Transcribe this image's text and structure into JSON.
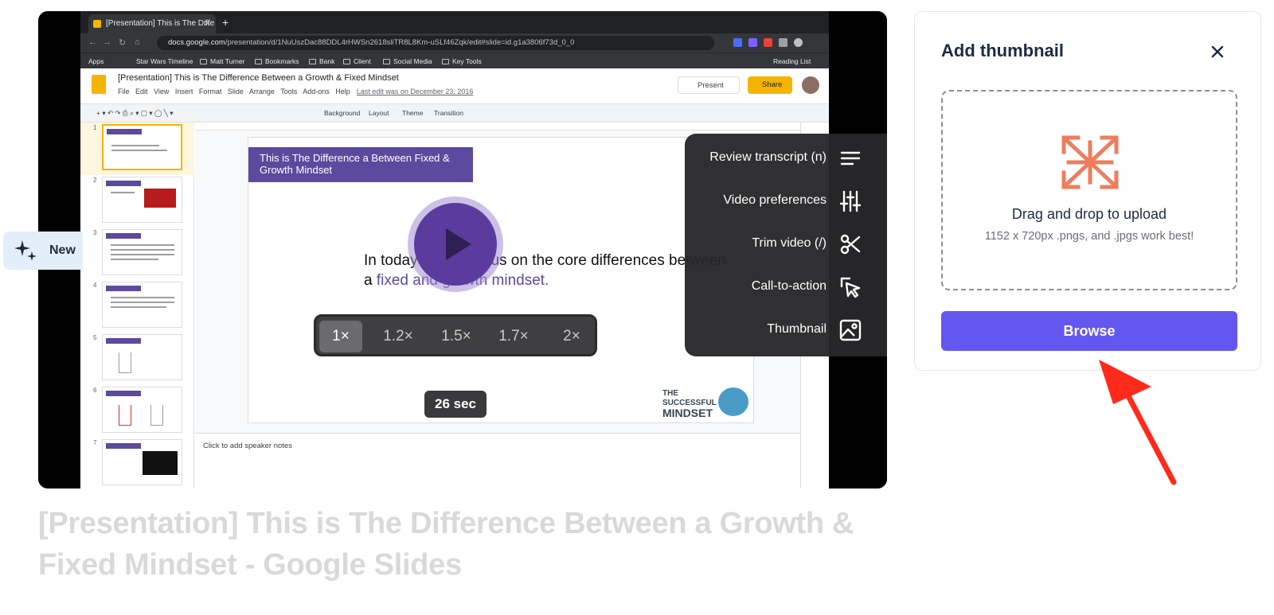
{
  "browser": {
    "tab_title": "[Presentation] This is The Diffe",
    "url_host": "docs.google.com",
    "url_path": "/presentation/d/1NuUszDac88DDL4rHWSn2618sliTR8L8Km-uSLf46Zqk/edit#slide=id.g1a3806f73d_0_0",
    "bookmarks": [
      "Apps",
      "Star Wars Timeline",
      "Matt Turner",
      "Bookmarks",
      "Bank",
      "Client",
      "Social Media",
      "Key Tools",
      "Reading List"
    ]
  },
  "slides_app": {
    "doc_title": "[Presentation] This is The Difference Between a Growth & Fixed Mindset",
    "menu": "File Edit View Insert Format Slide Arrange Tools Add-ons Help",
    "last_edit": "Last edit was on December 23, 2016",
    "present_label": "Present",
    "share_label": "Share",
    "toolbar": [
      "Background",
      "Layout",
      "Theme",
      "Transition"
    ],
    "slide_numbers": [
      "1",
      "2",
      "3",
      "4",
      "5",
      "6",
      "7"
    ],
    "slide_heading": "This is The  Difference a Between Fixed & Growth Mindset",
    "slide_body_start": "In today we will focus on the core differences between a ",
    "slide_body_highlight": "fixed and growth mindset.",
    "brand_small": "THE",
    "brand_line1": "SUCCESSFUL",
    "brand_line2": "MINDSET",
    "speaker_notes": "Click to add speaker notes"
  },
  "player": {
    "speeds": [
      "1×",
      "1.2×",
      "1.5×",
      "1.7×",
      "2×"
    ],
    "selected_speed": "1×",
    "duration": "26 sec",
    "menu": [
      {
        "label": "Review transcript (n)",
        "icon": "lines-icon"
      },
      {
        "label": "Video preferences",
        "icon": "sliders-icon"
      },
      {
        "label": "Trim video (/)",
        "icon": "scissors-icon"
      },
      {
        "label": "Call-to-action",
        "icon": "cursor-click-icon"
      },
      {
        "label": "Thumbnail",
        "icon": "image-icon"
      }
    ],
    "new_badge": "New"
  },
  "video_title": "[Presentation] This is The Difference Between a Growth & Fixed Mindset - Google Slides",
  "thumbnail_panel": {
    "title": "Add thumbnail",
    "drop_main": "Drag and drop to upload",
    "drop_sub": "1152 x 720px .pngs, and .jpgs work best!",
    "browse_label": "Browse"
  },
  "colors": {
    "accent": "#6457f0",
    "upload_icon": "#ef7d5d",
    "arrow": "#ff2a1a",
    "slide_purple": "#5c4a9e"
  }
}
